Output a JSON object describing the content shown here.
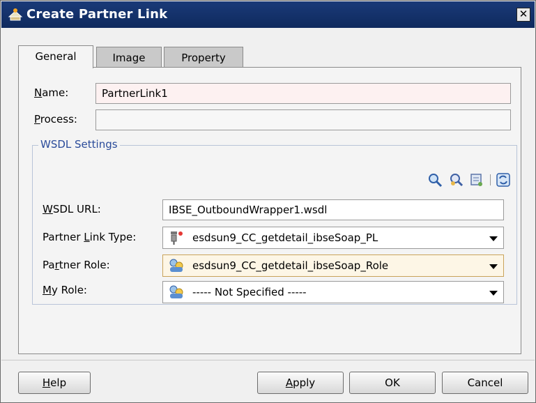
{
  "window": {
    "title": "Create Partner Link",
    "close_label": "✕"
  },
  "tabs": [
    {
      "label": "General",
      "active": true
    },
    {
      "label": "Image",
      "active": false
    },
    {
      "label": "Property",
      "active": false
    }
  ],
  "general": {
    "name": {
      "mnemonic": "N",
      "rest": "ame:",
      "value": "PartnerLink1"
    },
    "process": {
      "mnemonic": "P",
      "rest": "rocess:",
      "value": ""
    }
  },
  "wsdl": {
    "legend": "WSDL Settings",
    "toolbar_icons": [
      "search-icon",
      "browse-services-icon",
      "define-adapter-icon",
      "refresh-icon"
    ],
    "url": {
      "mnemonic": "W",
      "rest": "SDL URL:",
      "value": "IBSE_OutboundWrapper1.wsdl"
    },
    "partner_link_type": {
      "pre": "Partner ",
      "mnemonic": "L",
      "rest": "ink Type:",
      "value": "esdsun9_CC_getdetail_ibseSoap_PL"
    },
    "partner_role": {
      "pre": "Pa",
      "mnemonic": "r",
      "rest": "tner Role:",
      "value": "esdsun9_CC_getdetail_ibseSoap_Role"
    },
    "my_role": {
      "pre": "",
      "mnemonic": "M",
      "rest": "y Role:",
      "value": "----- Not Specified -----"
    }
  },
  "buttons": {
    "help": {
      "mnemonic": "H",
      "rest": "elp"
    },
    "apply": {
      "mnemonic": "A",
      "rest": "pply"
    },
    "ok": "OK",
    "cancel": "Cancel"
  },
  "colors": {
    "titlebar": "#0f2a5e",
    "legend": "#2a4b9a",
    "focused_combo": "#fdf6e6"
  }
}
